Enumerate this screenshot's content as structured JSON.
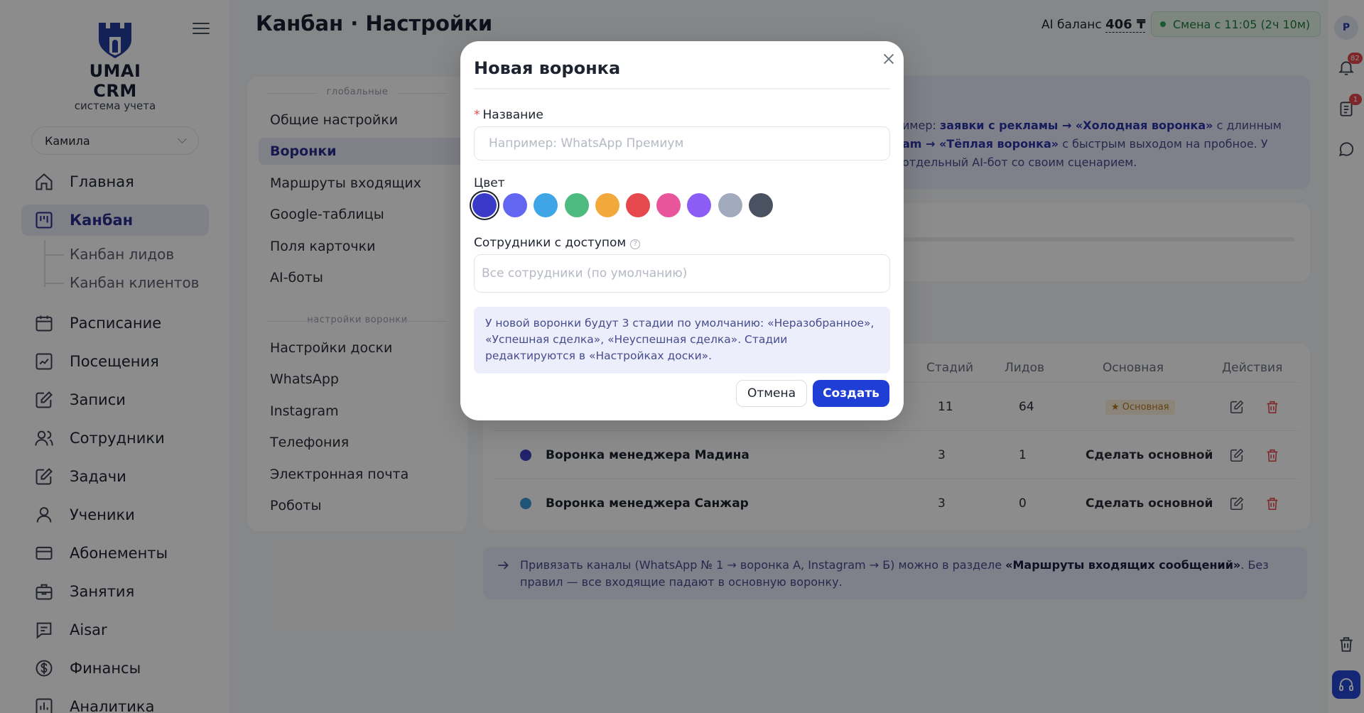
{
  "app": {
    "logo_title": "UMAI CRM",
    "logo_subtitle": "система учета"
  },
  "sidebar": {
    "user": "Камила",
    "items": [
      {
        "label": "Главная",
        "icon": "home-icon"
      },
      {
        "label": "Канбан",
        "icon": "kanban-icon",
        "active": true
      },
      {
        "label": "Расписание",
        "icon": "calendar-icon"
      },
      {
        "label": "Посещения",
        "icon": "chart-check-icon"
      },
      {
        "label": "Записи",
        "icon": "edit-icon"
      },
      {
        "label": "Сотрудники",
        "icon": "users-icon"
      },
      {
        "label": "Задачи",
        "icon": "task-icon"
      },
      {
        "label": "Ученики",
        "icon": "user-icon"
      },
      {
        "label": "Абонементы",
        "icon": "card-icon"
      },
      {
        "label": "Занятия",
        "icon": "briefcase-icon"
      },
      {
        "label": "Aisar",
        "icon": "message-icon"
      },
      {
        "label": "Финансы",
        "icon": "dollar-icon"
      },
      {
        "label": "Аналитика",
        "icon": "analytics-icon"
      }
    ],
    "sub_items": [
      "Канбан лидов",
      "Канбан клиентов"
    ]
  },
  "header": {
    "title": "Канбан · Настройки",
    "ai_balance_label": "AI баланс",
    "ai_balance_value": "406 ₸",
    "shift": "Смена с 11:05 (2ч 10м)"
  },
  "rail": {
    "avatar": "Р",
    "notifications_count": "82",
    "tasks_count": "1"
  },
  "settings_menu": {
    "group_global": "глобальные",
    "global_items": [
      "Общие настройки",
      "Воронки",
      "Маршруты входящих",
      "Google-таблицы",
      "Поля карточки",
      "AI-боты"
    ],
    "group_funnel": "настройки воронки",
    "funnel_items": [
      "Настройки доски",
      "WhatsApp",
      "Instagram",
      "Телефония",
      "Электронная почта",
      "Роботы"
    ]
  },
  "banner": {
    "line1_prefix": "имер: ",
    "line1_bold": "заявки с рекламы → «Холодная воронка»",
    "line1_suffix": " с длинным",
    "line2_bold": "am → «Тёплая воронка»",
    "line2_suffix": " с быстрым выходом на пробное. У",
    "line3": " отдельный AI-бот со своим сценарием."
  },
  "table": {
    "headers": {
      "stages": "Стадий",
      "leads": "Лидов",
      "main": "Основная",
      "actions": "Действия"
    },
    "rows": [
      {
        "name": "",
        "color": "#3b3fc4",
        "stages": "11",
        "leads": "64",
        "main_label": "Основная",
        "is_main": true
      },
      {
        "name": "Воронка менеджера Мадина",
        "color": "#3b3fc4",
        "stages": "3",
        "leads": "1",
        "main_label": "Сделать основной",
        "is_main": false
      },
      {
        "name": "Воронка менеджера Санжар",
        "color": "#3b9ad9",
        "stages": "3",
        "leads": "0",
        "main_label": "Сделать основной",
        "is_main": false
      }
    ]
  },
  "route_note": {
    "prefix": "Привязать каналы (WhatsApp № 1 → воронка А, Instagram → Б) можно в разделе ",
    "bold": "«Маршруты входящих сообщений»",
    "suffix": ". Без правил — все входящие падают в основную воронку."
  },
  "modal": {
    "title": "Новая воронка",
    "name_label": "Название",
    "name_required_mark": "*",
    "name_placeholder": "Например: WhatsApp Премиум",
    "name_value": "",
    "color_label": "Цвет",
    "colors": [
      "#3a3ac8",
      "#6366f1",
      "#3ea5e6",
      "#4dbb7f",
      "#f2a93b",
      "#e5484d",
      "#e8559a",
      "#8b5cf6",
      "#a2abbd",
      "#4a5262"
    ],
    "selected_color_index": 0,
    "access_label": "Сотрудники с доступом",
    "access_help": "?",
    "access_placeholder": "Все сотрудники (по умолчанию)",
    "info_text": "У новой воронки будут 3 стадии по умолчанию: «Неразобранное», «Успешная сделка», «Неуспешная сделка». Стадии редактируются в «Настройках доски».",
    "cancel_label": "Отмена",
    "create_label": "Создать"
  }
}
